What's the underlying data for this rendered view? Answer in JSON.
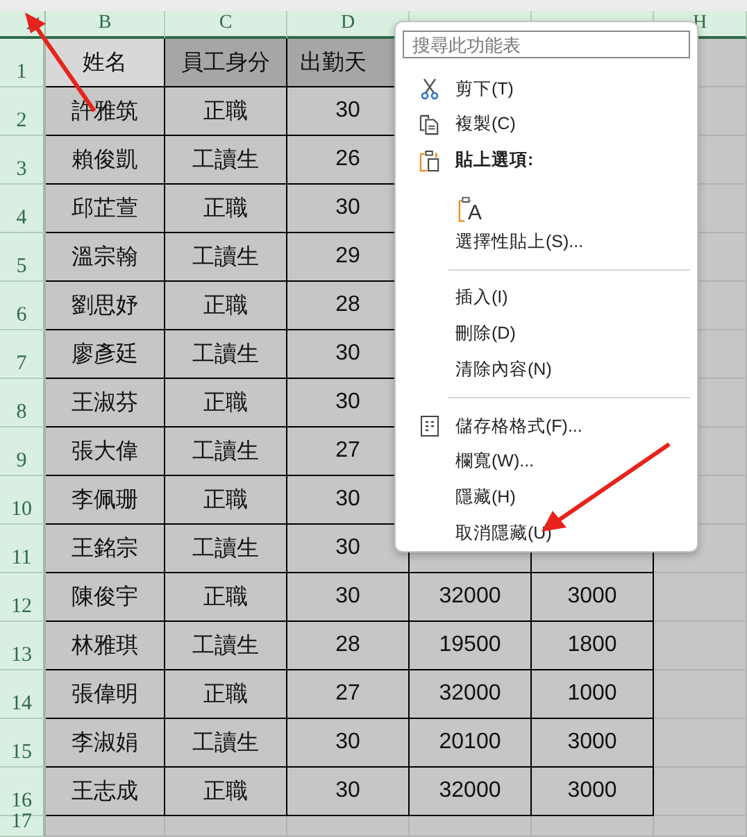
{
  "sheet": {
    "columns": [
      {
        "label": "B"
      },
      {
        "label": "C"
      },
      {
        "label": "D"
      },
      {},
      {},
      {
        "label": "H"
      }
    ],
    "rows": [
      {
        "number": "1",
        "cells": [
          "姓名",
          "員工身分",
          "出勤天"
        ]
      },
      {
        "number": "2",
        "cells": [
          "許雅筑",
          "正職",
          "30"
        ]
      },
      {
        "number": "3",
        "cells": [
          "賴俊凱",
          "工讀生",
          "26"
        ]
      },
      {
        "number": "4",
        "cells": [
          "邱芷萱",
          "正職",
          "30"
        ]
      },
      {
        "number": "5",
        "cells": [
          "溫宗翰",
          "工讀生",
          "29"
        ]
      },
      {
        "number": "6",
        "cells": [
          "劉思妤",
          "正職",
          "28"
        ]
      },
      {
        "number": "7",
        "cells": [
          "廖彥廷",
          "工讀生",
          "30"
        ]
      },
      {
        "number": "8",
        "cells": [
          "王淑芬",
          "正職",
          "30"
        ]
      },
      {
        "number": "9",
        "cells": [
          "張大偉",
          "工讀生",
          "27"
        ]
      },
      {
        "number": "10",
        "cells": [
          "李佩珊",
          "正職",
          "30"
        ]
      },
      {
        "number": "11",
        "cells": [
          "王銘宗",
          "工讀生",
          "30"
        ]
      },
      {
        "number": "12",
        "cells": [
          "陳俊宇",
          "正職",
          "30",
          "32000",
          "3000"
        ]
      },
      {
        "number": "13",
        "cells": [
          "林雅琪",
          "工讀生",
          "28",
          "19500",
          "1800"
        ]
      },
      {
        "number": "14",
        "cells": [
          "張偉明",
          "正職",
          "27",
          "32000",
          "1000"
        ]
      },
      {
        "number": "15",
        "cells": [
          "李淑娟",
          "工讀生",
          "30",
          "20100",
          "3000"
        ]
      },
      {
        "number": "16",
        "cells": [
          "王志成",
          "正職",
          "30",
          "32000",
          "3000"
        ]
      },
      {
        "number": "17",
        "cells": []
      }
    ]
  },
  "context_menu": {
    "search": {
      "placeholder": "搜尋此功能表"
    },
    "items": [
      {
        "kind": "cut",
        "label": "剪下(T)"
      },
      {
        "kind": "copy",
        "label": "複製(C)"
      },
      {
        "kind": "heading",
        "label": "貼上選項:"
      },
      {
        "kind": "paste-option",
        "letter": "A"
      },
      {
        "kind": "item",
        "label": "選擇性貼上(S)..."
      },
      {
        "kind": "separator"
      },
      {
        "kind": "item",
        "label": "插入(I)"
      },
      {
        "kind": "item",
        "label": "刪除(D)"
      },
      {
        "kind": "item",
        "label": "清除內容(N)"
      },
      {
        "kind": "separator"
      },
      {
        "kind": "format",
        "label": "儲存格格式(F)..."
      },
      {
        "kind": "item",
        "label": "欄寬(W)..."
      },
      {
        "kind": "item",
        "label": "隱藏(H)"
      },
      {
        "kind": "item",
        "label": "取消隱藏(U)"
      }
    ]
  }
}
